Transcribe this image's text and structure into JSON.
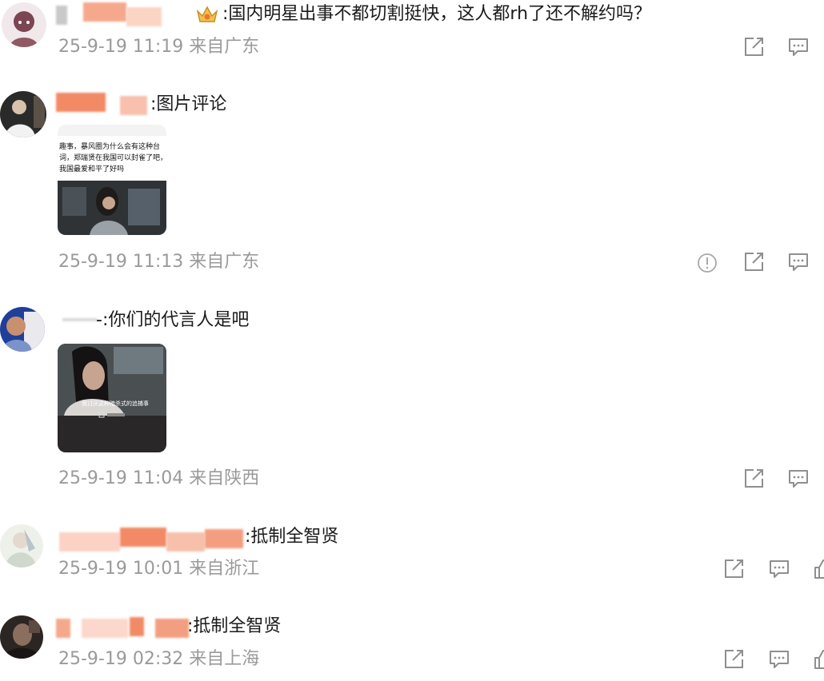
{
  "comments": [
    {
      "text": ":国内明星出事不都切割挺快，这人都rh了还不解约吗？",
      "meta": "25-9-19 11:19 来自广东",
      "has_badge": true,
      "actions": [
        "share-icon",
        "comment-icon"
      ]
    },
    {
      "text": ":图片评论",
      "meta": "25-9-19 11:13 来自广东",
      "image": {
        "caption_lines": [
          "趣事，暴风圈为什么会有这种台",
          "词，郑瑞贤在我国可以封雀了吧，",
          "我国最爱和平了好吗"
        ]
      },
      "actions": [
        "report-icon",
        "share-icon",
        "comment-icon"
      ]
    },
    {
      "text": "-:你们的代言人是吧",
      "meta": "25-9-19 11:04 来自陕西",
      "image": {
        "caption": "我讨厌这种暗杀式的追捕事"
      },
      "actions": [
        "share-icon",
        "comment-icon"
      ]
    },
    {
      "text": ":抵制全智贤",
      "meta": "25-9-19 10:01 来自浙江",
      "actions": [
        "share-icon",
        "comment-icon",
        "like-icon"
      ]
    },
    {
      "text": ":抵制全智贤",
      "meta": "25-9-19 02:32 来自上海",
      "actions": [
        "share-icon",
        "comment-icon",
        "like-icon"
      ]
    }
  ],
  "colors": {
    "text": "#1a1a1a",
    "meta": "#9a9a9a",
    "icon": "#8f8f8f",
    "mosaic": "#f07a55"
  }
}
